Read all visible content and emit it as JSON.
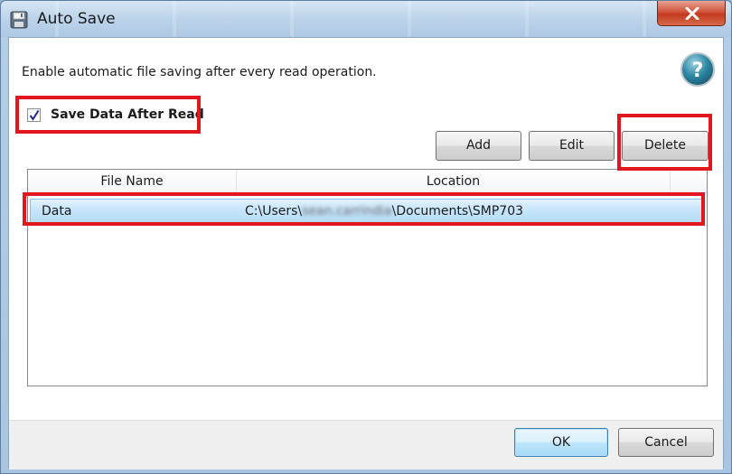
{
  "window": {
    "title": "Auto Save",
    "description": "Enable automatic file saving after every read operation."
  },
  "options": {
    "save_after_read_label": "Save Data After Read",
    "save_after_read_checked": true
  },
  "toolbar": {
    "add_label": "Add",
    "edit_label": "Edit",
    "delete_label": "Delete"
  },
  "grid": {
    "columns": [
      "File Name",
      "Location"
    ],
    "rows": [
      {
        "file_name": "Data",
        "location_prefix": "C:\\Users\\",
        "location_redacted": "sean.carrindia",
        "location_suffix": "\\Documents\\SMP703"
      }
    ]
  },
  "footer": {
    "ok_label": "OK",
    "cancel_label": "Cancel"
  },
  "colors": {
    "highlight": "#e1161e",
    "selection": "#c8e6fb",
    "accent": "#3c7fb1"
  },
  "icons": {
    "app": "floppy-disk-icon",
    "close": "close-icon",
    "help": "help-icon",
    "check": "checkmark-icon"
  }
}
